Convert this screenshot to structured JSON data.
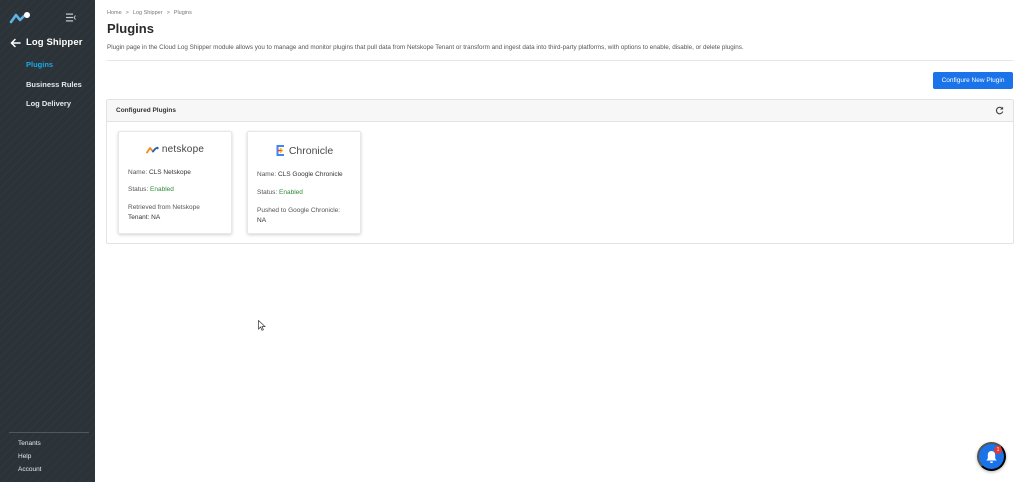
{
  "sidebar": {
    "module_title": "Log Shipper",
    "items": [
      {
        "label": "Plugins",
        "active": true
      },
      {
        "label": "Business Rules",
        "active": false
      },
      {
        "label": "Log Delivery",
        "active": false
      }
    ],
    "bottom_links": [
      "Tenants",
      "Help",
      "Account"
    ]
  },
  "breadcrumb": [
    "Home",
    ">",
    "Log Shipper",
    ">",
    "Plugins"
  ],
  "page": {
    "title": "Plugins",
    "description": "Plugin page in the Cloud Log Shipper module allows you to manage and monitor plugins that pull data from Netskope Tenant or transform and ingest data into third-party platforms, with options to enable, disable, or delete plugins."
  },
  "configure_button": "Configure New Plugin",
  "panel": {
    "title": "Configured Plugins"
  },
  "cards": [
    {
      "logo_text": "netskope",
      "name_label": "Name:",
      "name_value": "CLS Netskope",
      "status_label": "Status:",
      "status_value": "Enabled",
      "info_line1": "Retrieved from Netskope",
      "info_line2": "Tenant: NA"
    },
    {
      "logo_text": "Chronicle",
      "name_label": "Name:",
      "name_value": "CLS Google Chronicle",
      "status_label": "Status:",
      "status_value": "Enabled",
      "info_line1": "Pushed to Google Chronicle:",
      "info_line2": "NA"
    }
  ],
  "notifications": {
    "count": "1"
  },
  "colors": {
    "sidebar_bg": "#2b3338",
    "accent": "#1a73e8",
    "active_nav": "#1aa9e8",
    "status_enabled": "#2e8b3a",
    "badge": "#e53935"
  }
}
